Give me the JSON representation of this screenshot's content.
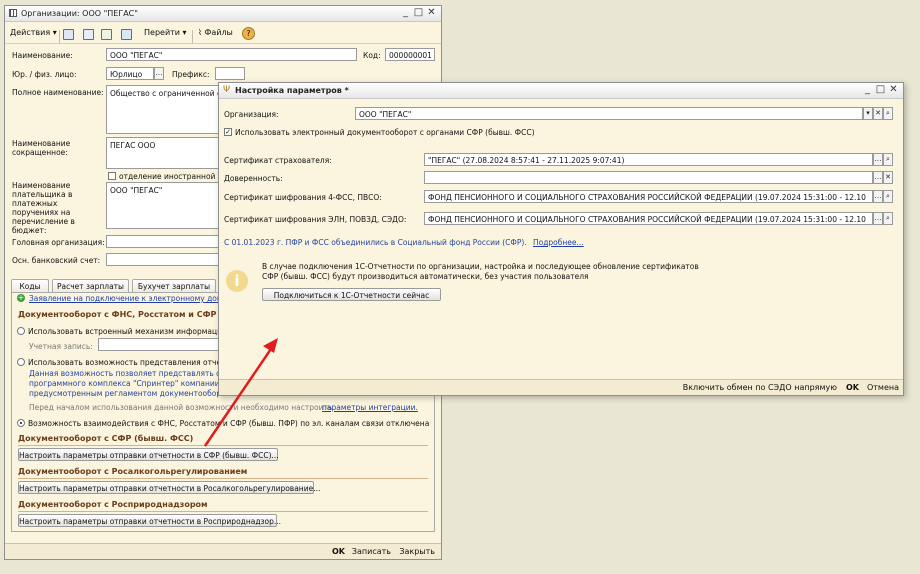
{
  "main_window": {
    "title": "Организации: ООО \"ПЕГАС\"",
    "toolbar": {
      "actions": "Действия",
      "goto": "Перейти",
      "files": "Файлы",
      "help": "?"
    },
    "fields": {
      "name_label": "Наименование:",
      "name_value": "ООО \"ПЕГАС\"",
      "code_label": "Код:",
      "code_value": "000000001",
      "legal_label": "Юр. / физ. лицо:",
      "legal_value": "Юрлицо",
      "prefix_label": "Префикс:",
      "full_label": "Полное наименование:",
      "full_value": "Общество с ограниченной о",
      "short_label": "Наименование сокращенное:",
      "short_value": "ПЕГАС ООО",
      "foreign_check": "отделение иностранной ор",
      "payer_label": "Наименование плательщика в платежных поручениях на перечисление в бюджет:",
      "payer_value": "ООО \"ПЕГАС\"",
      "head_label": "Головная организация:",
      "bank_label": "Осн. банковский счет:"
    },
    "tabs": [
      "Коды",
      "Расчет зарплаты",
      "Бухучет зарплаты"
    ],
    "content": {
      "application_link": "Заявление на подключение к электронному доку",
      "fns_section": "Документооборот с ФНС, Росстатом и СФР",
      "builtin_radio": "Использовать встроенный механизм информаци",
      "account_label": "Учетная запись:",
      "alt_radio": "Использовать возможность представления отчет",
      "alt_desc_1": "Данная возможность позволяет представлять от",
      "alt_desc_2": "программного комплекса \"Спринтер\" компании \"",
      "alt_desc_3": "предусмотренным регламентом документооборот",
      "integration_note": "Перед началом использования данной возможности необходимо настроить",
      "integration_link": "параметры интеграции.",
      "disable_radio": "Возможность взаимодействия с ФНС, Росстатом и СФР (бывш. ПФР) по эл. каналам связи отключена",
      "sfr_section": "Документооборот с СФР (бывш. ФСС)",
      "sfr_button": "Настроить параметры отправки отчетности в СФР (бывш. ФСС)...",
      "ral_section": "Документооборот с Росалкогольрегулированием",
      "ral_button": "Настроить параметры отправки отчетности в Росалкогольрегулирование...",
      "rpn_section": "Документооборот с Росприроднадзором",
      "rpn_button": "Настроить параметры отправки отчетности в Росприроднадзор..."
    },
    "footer": {
      "ok": "OK",
      "write": "Записать",
      "close": "Закрыть"
    }
  },
  "dialog": {
    "title": "Настройка параметров *",
    "org_label": "Организация:",
    "org_value": "ООО \"ПЕГАС\"",
    "use_edo_check": "Использовать электронный документооборот с органами СФР (бывш. ФСС)",
    "cert_insurer_label": "Сертификат страхователя:",
    "cert_insurer_value": "\"ПЕГАС\" (27.08.2024 8:57:41 - 27.11.2025 9:07:41)",
    "power_label": "Доверенность:",
    "cert_4fss_label": "Сертификат шифрования 4-ФСС, ПВСО:",
    "cert_4fss_value": "ФОНД ПЕНСИОННОГО И СОЦИАЛЬНОГО СТРАХОВАНИЯ РОССИЙСКОЙ ФЕДЕРАЦИИ (19.07.2024 15:31:00 - 12.10",
    "cert_eln_label": "Сертификат шифрования ЭЛН, ПОВЗД, СЭДО:",
    "cert_eln_value": "ФОНД ПЕНСИОННОГО И СОЦИАЛЬНОГО СТРАХОВАНИЯ РОССИЙСКОЙ ФЕДЕРАЦИИ (19.07.2024 15:31:00 - 12.10",
    "merge_note": "С 01.01.2023 г. ПФР и ФСС объединились в Социальный фонд России (СФР).",
    "more_link": "Подробнее...",
    "info_text_1": "В случае подключения 1С-Отчетности по организации, настройка и последующее обновление сертификатов",
    "info_text_2": "СФР (бывш. ФСС) будут производиться автоматически, без участия пользователя",
    "connect_button": "Подключиться к 1С-Отчетности сейчас",
    "footer": {
      "sedo": "Включить обмен по СЭДО напрямую",
      "ok": "OK",
      "cancel": "Отмена"
    }
  },
  "colors": {
    "window_bg": "#fbf5df",
    "section_title": "#6b3d1a",
    "link": "#1f3fa7",
    "arrow": "#e11c1c"
  }
}
